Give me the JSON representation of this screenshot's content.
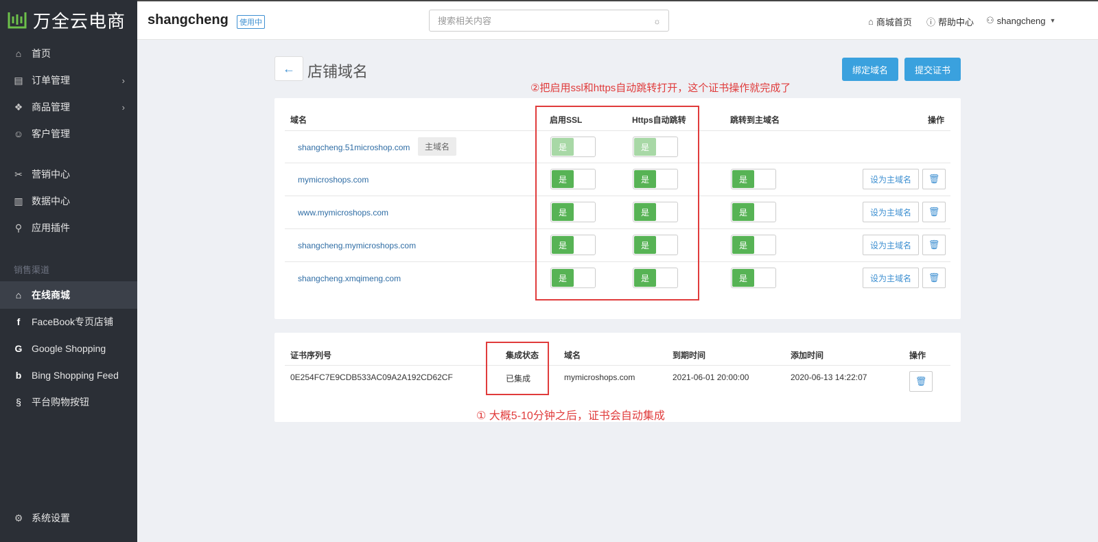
{
  "brand": {
    "logo_text": "万全云电商"
  },
  "sidebar": {
    "items": [
      {
        "label": "首页",
        "icon": "home-icon"
      },
      {
        "label": "订单管理",
        "icon": "order-icon"
      },
      {
        "label": "商品管理",
        "icon": "product-icon"
      },
      {
        "label": "客户管理",
        "icon": "customer-icon"
      },
      {
        "label": "营销中心",
        "icon": "marketing-icon"
      },
      {
        "label": "数据中心",
        "icon": "data-icon"
      },
      {
        "label": "应用插件",
        "icon": "plugin-icon"
      }
    ],
    "section_label": "销售渠道",
    "channels": [
      {
        "label": "在线商城",
        "icon": "store-icon"
      },
      {
        "label": "FaceBook专页店铺",
        "icon": "facebook-icon"
      },
      {
        "label": "Google Shopping",
        "icon": "google-icon"
      },
      {
        "label": "Bing Shopping Feed",
        "icon": "bing-icon"
      },
      {
        "label": "平台购物按钮",
        "icon": "buy-button-icon"
      }
    ],
    "settings_label": "系统设置"
  },
  "header": {
    "shop_name": "shangcheng",
    "status_badge": "使用中",
    "search_placeholder": "搜索相关内容",
    "links": {
      "store_home": "商城首页",
      "help": "帮助中心",
      "user": "shangcheng"
    }
  },
  "page": {
    "title": "店铺域名",
    "bind_domain_button": "绑定域名",
    "submit_cert_button": "提交证书"
  },
  "domains_table": {
    "headers": {
      "domain": "域名",
      "ssl": "启用SSL",
      "https": "Https自动跳转",
      "redirect": "跳转到主域名",
      "actions": "操作"
    },
    "primary_tag": "主域名",
    "toggle_label": "是",
    "set_primary_label": "设为主域名",
    "rows": [
      {
        "domain": "shangcheng.51microshop.com",
        "primary": true
      },
      {
        "domain": "mymicroshops.com",
        "primary": false
      },
      {
        "domain": "www.mymicroshops.com",
        "primary": false
      },
      {
        "domain": "shangcheng.mymicroshops.com",
        "primary": false
      },
      {
        "domain": "shangcheng.xmqimeng.com",
        "primary": false
      }
    ]
  },
  "cert_table": {
    "headers": {
      "serial": "证书序列号",
      "status": "集成状态",
      "domain": "域名",
      "expires": "到期时间",
      "added": "添加时间",
      "actions": "操作"
    },
    "rows": [
      {
        "serial": "0E254FC7E9CDB533AC09A2A192CD62CF",
        "status": "已集成",
        "domain": "mymicroshops.com",
        "expires": "2021-06-01 20:00:00",
        "added": "2020-06-13 14:22:07"
      }
    ]
  },
  "annotations": {
    "top": "②把启用ssl和https自动跳转打开，这个证书操作就完成了",
    "bottom": "① 大概5-10分钟之后，证书会自动集成"
  },
  "colors": {
    "sidebar_bg": "#2b2f36",
    "accent_blue": "#3aa1de",
    "toggle_green": "#57b355",
    "annotation_red": "#e03b3b"
  }
}
